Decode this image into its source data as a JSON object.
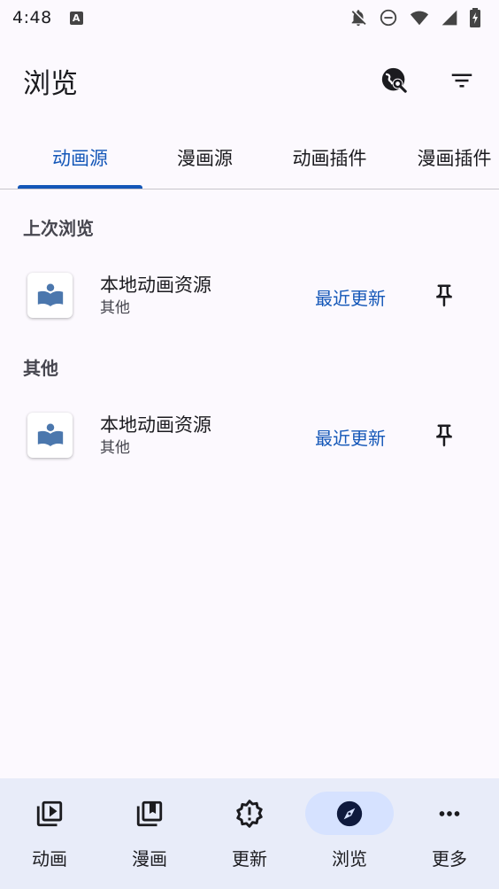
{
  "status_bar": {
    "time": "4:48",
    "badge": "A"
  },
  "header": {
    "title": "浏览",
    "actions": [
      "travel-explore-icon",
      "filter-icon"
    ]
  },
  "tabs": [
    {
      "label": "动画源",
      "active": true
    },
    {
      "label": "漫画源",
      "active": false
    },
    {
      "label": "动画插件",
      "active": false
    },
    {
      "label": "漫画插件",
      "active": false
    }
  ],
  "sections": [
    {
      "header": "上次浏览",
      "items": [
        {
          "name": "本地动画资源",
          "lang": "其他",
          "action": "最近更新"
        }
      ]
    },
    {
      "header": "其他",
      "items": [
        {
          "name": "本地动画资源",
          "lang": "其他",
          "action": "最近更新"
        }
      ]
    }
  ],
  "bottom_nav": [
    {
      "label": "动画",
      "icon": "video-library-icon",
      "active": false
    },
    {
      "label": "漫画",
      "icon": "collections-bookmark-icon",
      "active": false
    },
    {
      "label": "更新",
      "icon": "new-releases-icon",
      "active": false
    },
    {
      "label": "浏览",
      "icon": "explore-icon",
      "active": true
    },
    {
      "label": "更多",
      "icon": "more-horiz-icon",
      "active": false
    }
  ],
  "colors": {
    "accent": "#1457b8",
    "background": "#fcf9fe",
    "nav_background": "#e8ecf9",
    "nav_active_pill": "#d6e2ff"
  }
}
